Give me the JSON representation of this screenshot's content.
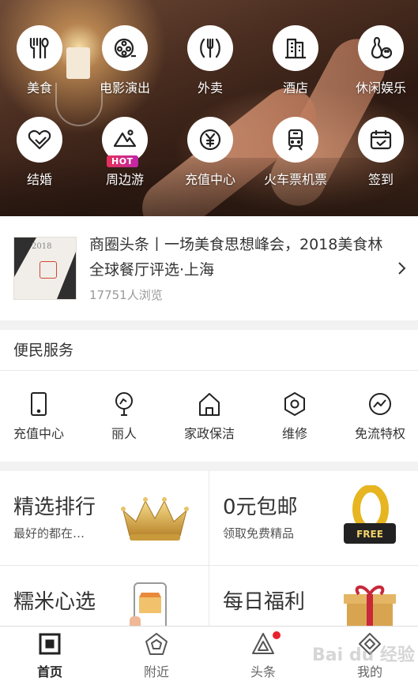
{
  "grid": [
    {
      "label": "美食",
      "icon": "fork-spoon-icon"
    },
    {
      "label": "电影演出",
      "icon": "film-reel-icon"
    },
    {
      "label": "外卖",
      "icon": "takeout-icon"
    },
    {
      "label": "酒店",
      "icon": "hotel-icon"
    },
    {
      "label": "休闲娱乐",
      "icon": "bowling-icon"
    },
    {
      "label": "结婚",
      "icon": "heart-icon"
    },
    {
      "label": "周边游",
      "icon": "mountain-icon",
      "badge": "HOT"
    },
    {
      "label": "充值中心",
      "icon": "yen-coin-icon"
    },
    {
      "label": "火车票机票",
      "icon": "train-icon"
    },
    {
      "label": "签到",
      "icon": "calendar-check-icon"
    }
  ],
  "news": {
    "title": "商圈头条丨一场美食思想峰会，2018美食林全球餐厅评选·上海",
    "views": "17751人浏览",
    "thumb_year": "2018"
  },
  "services": {
    "title": "便民服务",
    "items": [
      {
        "label": "充值中心",
        "icon": "phone-icon"
      },
      {
        "label": "丽人",
        "icon": "mirror-icon"
      },
      {
        "label": "家政保洁",
        "icon": "house-icon"
      },
      {
        "label": "维修",
        "icon": "hex-nut-icon"
      },
      {
        "label": "免流特权",
        "icon": "trend-icon"
      }
    ]
  },
  "cards": [
    {
      "title": "精选排行",
      "subtitle": "最好的都在…",
      "image": "crown-icon"
    },
    {
      "title": "0元包邮",
      "subtitle": "领取免费精品",
      "image": "free-badge-icon"
    },
    {
      "title": "糯米心选",
      "subtitle": "",
      "image": "phone-shop-icon"
    },
    {
      "title": "每日福利",
      "subtitle": "",
      "image": "gift-box-icon"
    }
  ],
  "tabs": [
    {
      "label": "首页",
      "icon": "home-square-icon",
      "active": true
    },
    {
      "label": "附近",
      "icon": "pentagon-icon",
      "active": false
    },
    {
      "label": "头条",
      "icon": "triangle-icon",
      "active": false,
      "dot": true
    },
    {
      "label": "我的",
      "icon": "diamond-icon",
      "active": false
    }
  ],
  "watermark": "Bai du 经验",
  "colors": {
    "accent": "#e8222d",
    "hot_badge": "#d8306f",
    "text": "#333333"
  }
}
